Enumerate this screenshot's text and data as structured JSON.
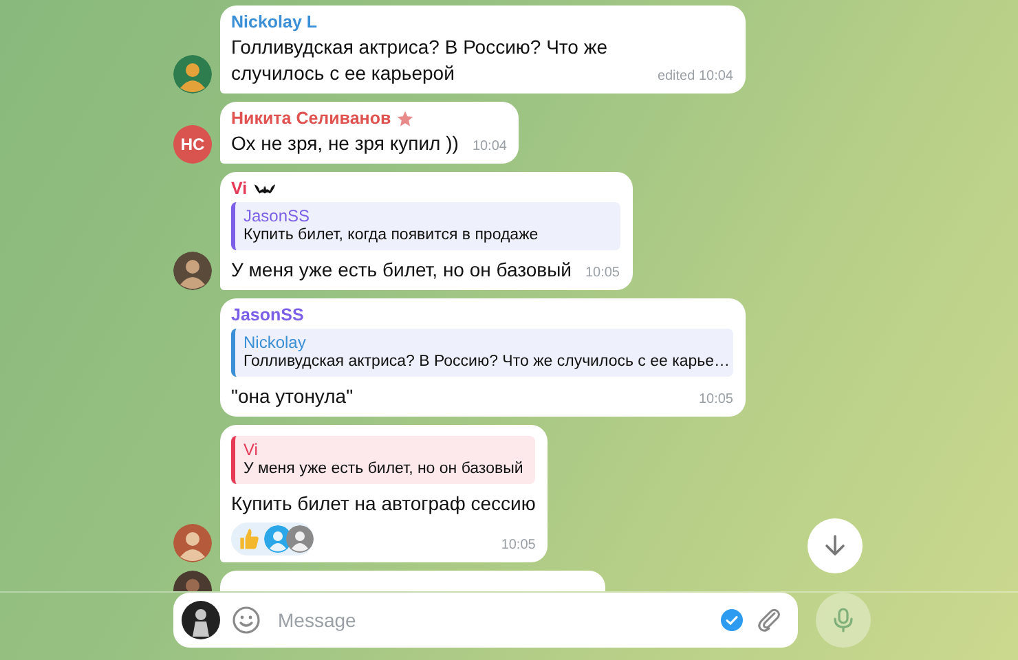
{
  "messages": [
    {
      "kind": "text",
      "sender": "Nickolay L",
      "color": "#3a8fd6",
      "avatar": {
        "kind": "photo"
      },
      "text": "Голливудская актриса? В Россию? Что же случилось с ее карьерой",
      "time": "edited 10:04"
    },
    {
      "kind": "text",
      "sender": "Никита Селиванов",
      "color": "#e0524f",
      "badge": {
        "kind": "star"
      },
      "avatar": {
        "kind": "initials",
        "initials": "НС",
        "color": "#d9534f"
      },
      "text": "Ох не зря, не зря купил ))",
      "time": "10:04"
    },
    {
      "kind": "text",
      "sender": "Vi",
      "color": "#e53956",
      "badge": {
        "kind": "bat"
      },
      "avatar": {
        "kind": "photo"
      },
      "reply": {
        "sender": "JasonSS",
        "color": "#7b5fe6",
        "text": "Купить билет, когда появится в продаже"
      },
      "text": "У меня уже есть билет, но он базовый",
      "time": "10:05"
    },
    {
      "kind": "text",
      "sender": "JasonSS",
      "color": "#7b5fe6",
      "reply": {
        "sender": "Nickolay",
        "color": "#3a8fd6",
        "text": "Голливудская актриса? В Россию? Что же случилось с ее карье…"
      },
      "text": "\"она утонула\"",
      "time": "10:05"
    },
    {
      "kind": "text",
      "avatar": {
        "kind": "photo"
      },
      "reply": {
        "sender": "Vi",
        "color": "#e53956",
        "text": "У меня уже есть билет, но он базовый"
      },
      "text": "Купить билет на автограф сессию",
      "reaction": {
        "kind": "thumbs_up",
        "reactors": [
          {
            "kind": "photo"
          },
          {
            "kind": "photo"
          }
        ]
      },
      "time": "10:05"
    },
    {
      "kind": "cut_off",
      "avatar": {
        "kind": "photo"
      }
    }
  ],
  "composer": {
    "placeholder": "Message"
  }
}
